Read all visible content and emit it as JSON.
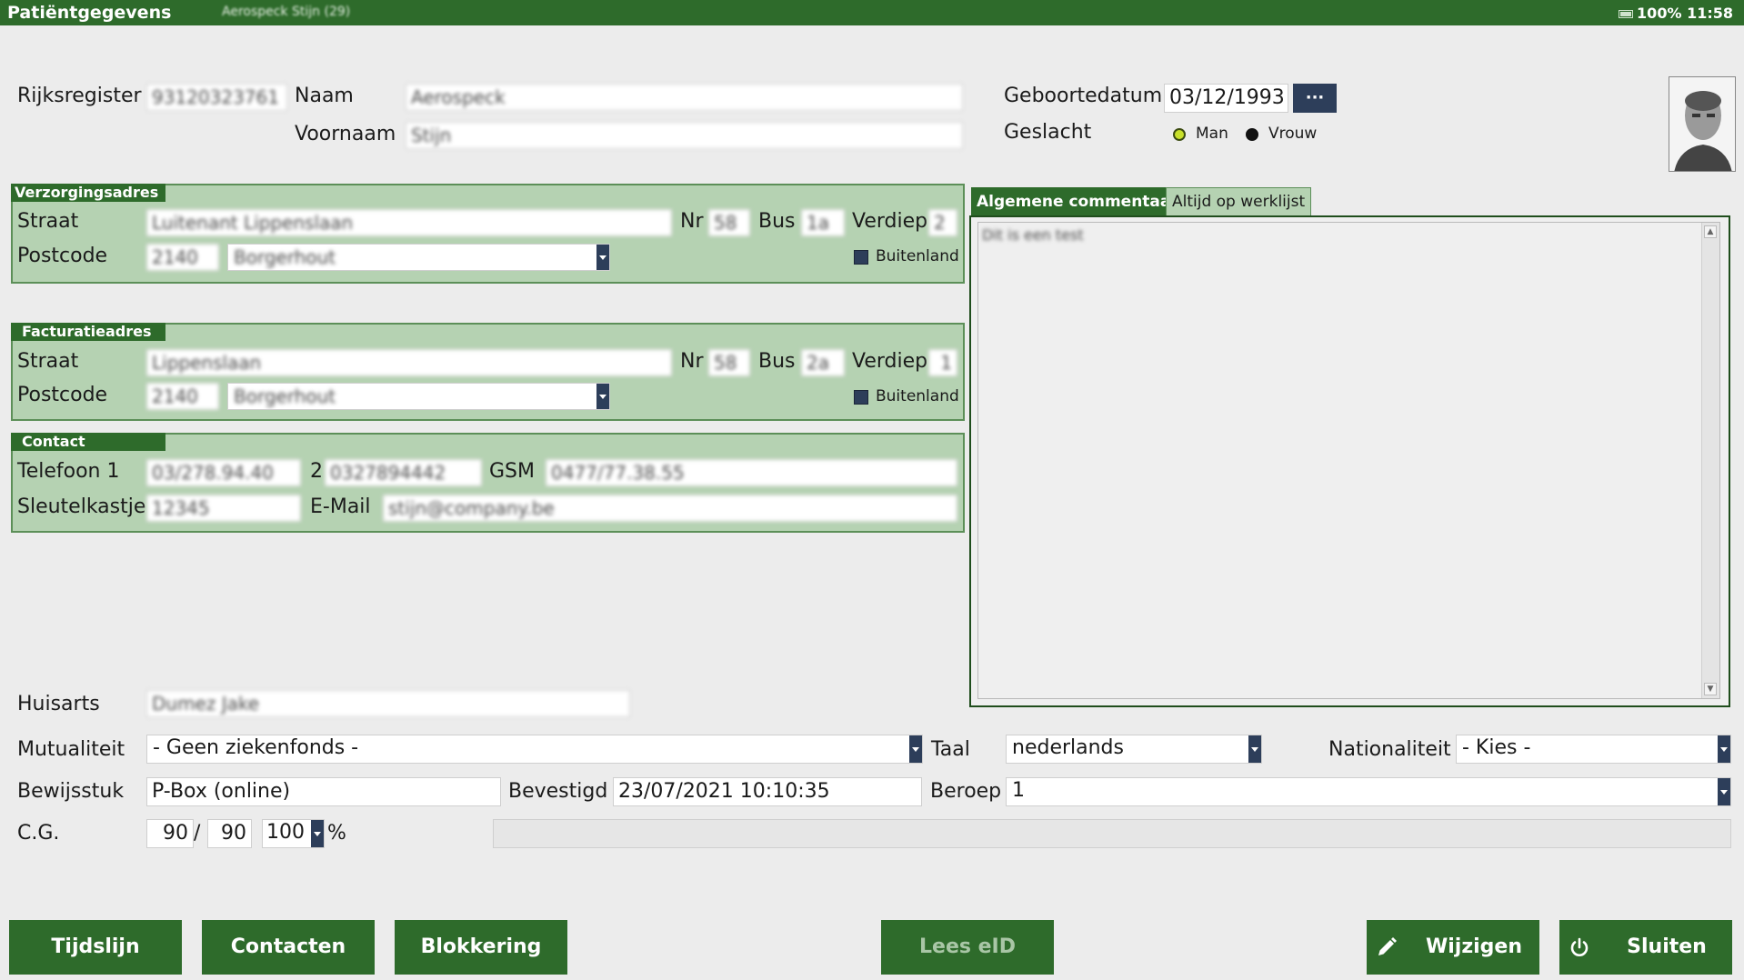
{
  "titlebar": {
    "title": "Patiëntgegevens",
    "subtitle": "Aerospeck Stijn (29)",
    "battery": "100%",
    "time": "11:58"
  },
  "patient": {
    "rijksregister_label": "Rijksregister",
    "rijksregister": "93120323761",
    "naam_label": "Naam",
    "naam": "Aerospeck",
    "voornaam_label": "Voornaam",
    "voornaam": "Stijn",
    "geboortedatum_label": "Geboortedatum",
    "geboortedatum": "03/12/1993",
    "date_picker_label": "···",
    "geslacht_label": "Geslacht",
    "man_label": "Man",
    "vrouw_label": "Vrouw"
  },
  "verzorging": {
    "title": "Verzorgingsadres",
    "straat_label": "Straat",
    "straat": "Luitenant Lippenslaan",
    "nr_label": "Nr",
    "nr": "58",
    "bus_label": "Bus",
    "bus": "1a",
    "verdiep_label": "Verdiep",
    "verdiep": "2",
    "postcode_label": "Postcode",
    "postcode": "2140",
    "gemeente": "Borgerhout",
    "buitenland_label": "Buitenland"
  },
  "facturatie": {
    "title": "Facturatieadres",
    "straat_label": "Straat",
    "straat": "Lippenslaan",
    "nr_label": "Nr",
    "nr": "58",
    "bus_label": "Bus",
    "bus": "2a",
    "verdiep_label": "Verdiep",
    "verdiep": "1",
    "postcode_label": "Postcode",
    "postcode": "2140",
    "gemeente": "Borgerhout",
    "buitenland_label": "Buitenland"
  },
  "contact": {
    "title": "Contact",
    "telefoon1_label": "Telefoon 1",
    "telefoon1": "03/278.94.40",
    "telefoon2_label": "2",
    "telefoon2": "0327894442",
    "gsm_label": "GSM",
    "gsm": "0477/77.38.55",
    "sleutelkastje_label": "Sleutelkastje",
    "sleutelkastje": "12345",
    "email_label": "E-Mail",
    "email": "stijn@company.be"
  },
  "comments": {
    "tab_active": "Algemene commentaar",
    "tab_other": "Altijd op werklijst",
    "text": "Dit is een test"
  },
  "admin": {
    "huisarts_label": "Huisarts",
    "huisarts": "Dumez Jake",
    "mutualiteit_label": "Mutualiteit",
    "mutualiteit": "- Geen ziekenfonds -",
    "taal_label": "Taal",
    "taal": "nederlands",
    "nationaliteit_label": "Nationaliteit",
    "nationaliteit": "- Kies -",
    "bewijsstuk_label": "Bewijsstuk",
    "bewijsstuk": "P-Box (online)",
    "bevestigd_label": "Bevestigd",
    "bevestigd": "23/07/2021 10:10:35",
    "beroep_label": "Beroep",
    "beroep": "1",
    "cg_label": "C.G.",
    "cg1": "90",
    "cg_sep": "/",
    "cg2": "90",
    "cg3": "100",
    "cg_unit": "%"
  },
  "buttons": {
    "tijdslijn": "Tijdslijn",
    "contacten": "Contacten",
    "blokkering": "Blokkering",
    "lees_eid": "Lees eID",
    "wijzigen": "Wijzigen",
    "sluiten": "Sluiten"
  },
  "colors": {
    "header_green": "#2e6b2b",
    "group_green": "#b5d2b2",
    "dark_navy": "#2d3e5a",
    "radio_selected": "#c8e02a"
  }
}
